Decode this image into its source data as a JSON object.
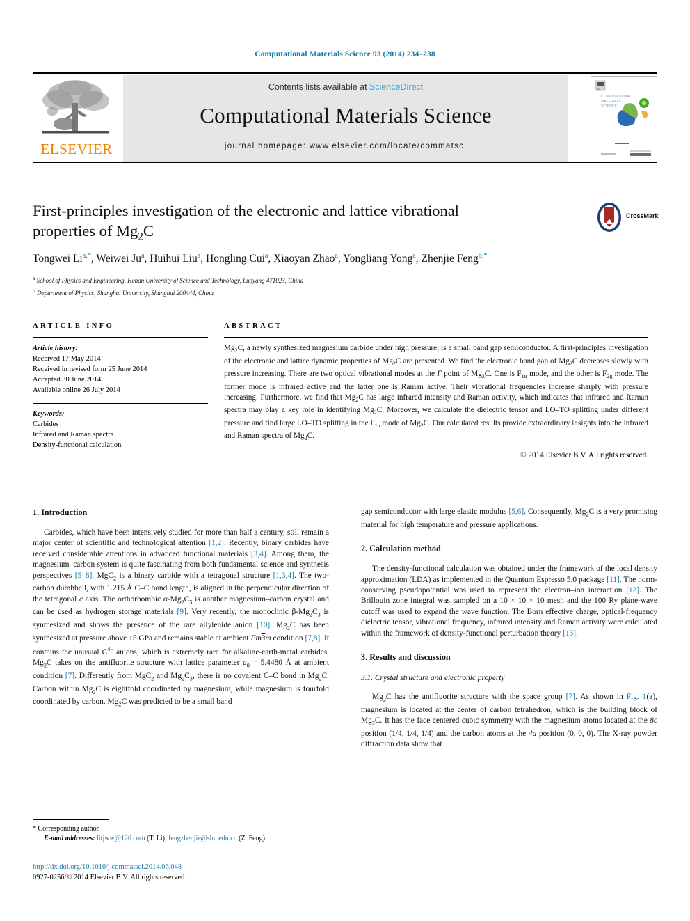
{
  "running_head": "Computational Materials Science 93 (2014) 234–238",
  "masthead": {
    "contents_prefix": "Contents lists available at ",
    "sciencedirect": "ScienceDirect",
    "journal_title": "Computational Materials Science",
    "homepage": "journal homepage: www.elsevier.com/locate/commatsci",
    "publisher_wordmark": "ELSEVIER",
    "cover_title_lines": [
      "COMPUTATIONAL",
      "MATERIALS",
      "SCIENCE"
    ]
  },
  "article": {
    "title_line1": "First-principles investigation of the electronic and lattice vibrational",
    "title_line2_pre": "properties of Mg",
    "title_sub": "2",
    "title_line2_post": "C",
    "crossmark_label": "CrossMark",
    "authors": [
      {
        "name": "Tongwei Li",
        "sup": "a,*"
      },
      {
        "name": "Weiwei Ju",
        "sup": "a"
      },
      {
        "name": "Huihui Liu",
        "sup": "a"
      },
      {
        "name": "Hongling Cui",
        "sup": "a"
      },
      {
        "name": "Xiaoyan Zhao",
        "sup": "a"
      },
      {
        "name": "Yongliang Yong",
        "sup": "a"
      },
      {
        "name": "Zhenjie Feng",
        "sup": "b,*"
      }
    ],
    "affiliations": [
      {
        "mark": "a",
        "text": "School of Physics and Engineering, Henan University of Science and Technology, Luoyang 471023, China"
      },
      {
        "mark": "b",
        "text": "Department of Physics, Shanghai University, Shanghai 200444, China"
      }
    ]
  },
  "article_info": {
    "heading": "ARTICLE INFO",
    "history_label": "Article history:",
    "history": [
      "Received 17 May 2014",
      "Received in revised form 25 June 2014",
      "Accepted 30 June 2014",
      "Available online 26 July 2014"
    ],
    "keywords_label": "Keywords:",
    "keywords": [
      "Carbides",
      "Infrared and Raman spectra",
      "Density-functional calculation"
    ]
  },
  "abstract": {
    "heading": "ABSTRACT",
    "copyright": "© 2014 Elsevier B.V. All rights reserved."
  },
  "body": {
    "left": {
      "section1_heading": "1. Introduction"
    },
    "right": {
      "section2_heading": "2. Calculation method",
      "section3_heading": "3. Results and discussion",
      "section31_heading": "3.1. Crystal structure and electronic property"
    }
  },
  "footnote": {
    "corresponding": "* Corresponding author.",
    "email_label": "E-mail addresses:",
    "email1": "litjww@126.com",
    "email1_suffix": "(T. Li),",
    "email2": "fengzhenjie@shu.edu.cn",
    "email2_suffix": "(Z. Feng)."
  },
  "doi_block": {
    "doi_url": "http://dx.doi.org/10.1016/j.commatsci.2014.06.048",
    "issn_line": "0927-0256/© 2014 Elsevier B.V. All rights reserved."
  },
  "colors": {
    "link_blue": "#1a7ba8",
    "sciencedirect_blue": "#3aa3d4",
    "elsevier_orange": "#ef8200",
    "band_grey": "#e6e6e6"
  }
}
